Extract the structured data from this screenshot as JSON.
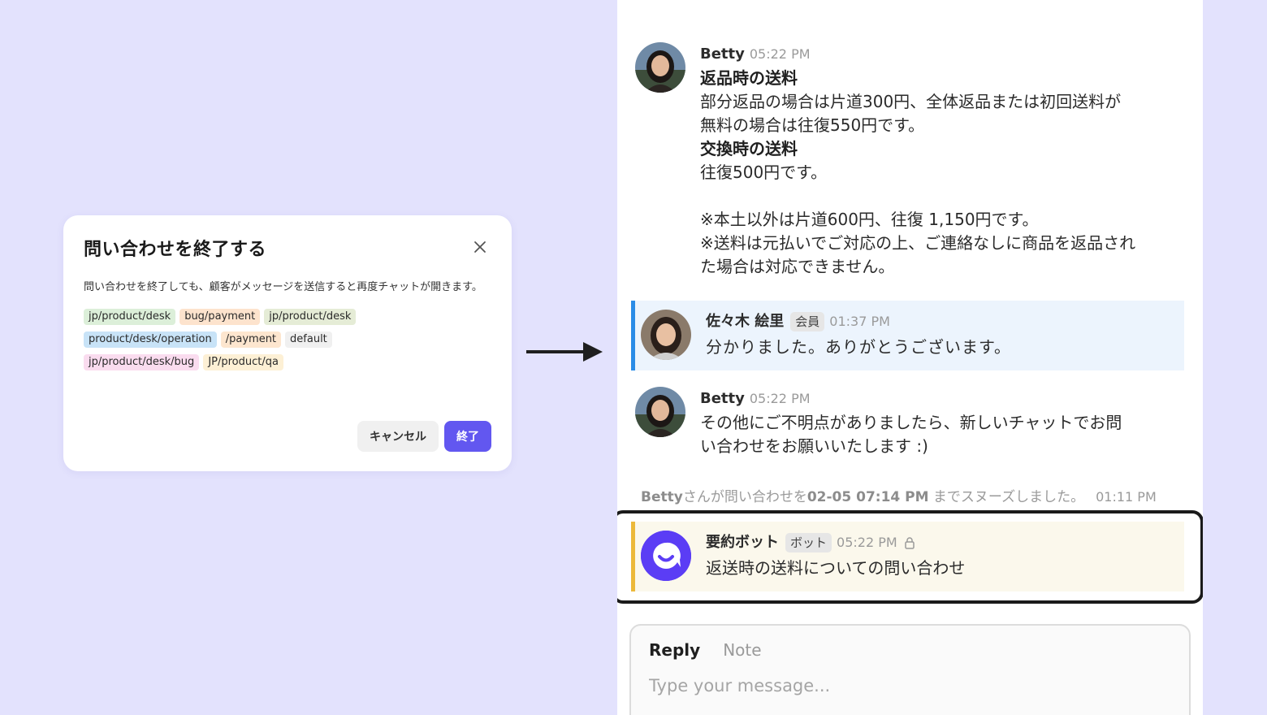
{
  "dialog": {
    "title": "問い合わせを終了する",
    "description": "問い合わせを終了しても、顧客がメッセージを送信すると再度チャットが開きます。",
    "tags": [
      {
        "label": "jp/product/desk",
        "color": "#dcefd9"
      },
      {
        "label": "bug/payment",
        "color": "#fde3cd"
      },
      {
        "label": "jp/product/desk",
        "color": "#e5ecd6"
      },
      {
        "label": "product/desk/operation",
        "color": "#c8e3f7"
      },
      {
        "label": "/payment",
        "color": "#fde6cf"
      },
      {
        "label": "default",
        "color": "#f0f0f0"
      },
      {
        "label": "jp/product/desk/bug",
        "color": "#fadcef"
      },
      {
        "label": "JP/product/qa",
        "color": "#fdf0d5"
      }
    ],
    "cancel_label": "キャンセル",
    "confirm_label": "終了"
  },
  "chat": {
    "msg1": {
      "name": "Betty",
      "time": "05:22 PM",
      "h1": "返品時の送料",
      "p1a": "部分返品の場合は片道300円、全体返品または初回送料が",
      "p1b": "無料の場合は往復550円です。",
      "h2": "交換時の送料",
      "p2": "往復500円です。",
      "n1": "※本土以外は片道600円、往復 1,150円です。",
      "n2a": "※送料は元払いでご対応の上、ご連絡なしに商品を返品され",
      "n2b": "た場合は対応できません。"
    },
    "msg2": {
      "name": "佐々木 絵里",
      "badge": "会員",
      "time": "01:37 PM",
      "text": "分かりました。ありがとうございます。"
    },
    "msg3": {
      "name": "Betty",
      "time": "05:22 PM",
      "line1": "その他にご不明点がありましたら、新しいチャットでお問",
      "line2": "い合わせをお願いいたします :)"
    },
    "system": {
      "actor": "Betty",
      "text1": "さんが問い合わせを",
      "until": "02-05 07:14 PM",
      "text2": " までスヌーズしました。",
      "time": "01:11 PM"
    },
    "msg4": {
      "name": "要約ボット",
      "badge": "ボット",
      "time": "05:22 PM",
      "text": "返送時の送料についての問い合わせ"
    }
  },
  "composer": {
    "tab_reply": "Reply",
    "tab_note": "Note",
    "placeholder": "Type your message..."
  }
}
